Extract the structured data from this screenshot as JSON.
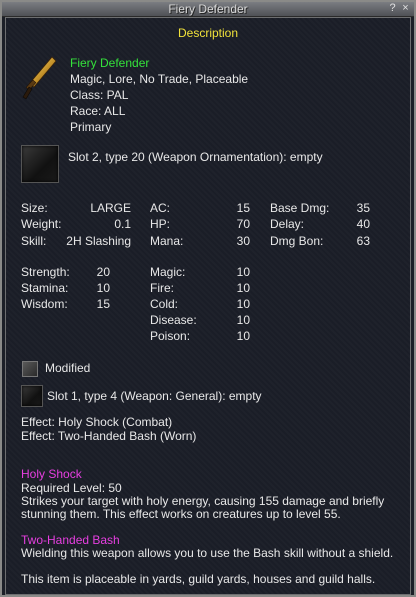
{
  "window": {
    "title": "Fiery Defender",
    "help_label": "?",
    "close_label": "×"
  },
  "header": {
    "title": "Description"
  },
  "item": {
    "name": "Fiery Defender",
    "flags": "Magic, Lore, No Trade, Placeable",
    "class": "Class: PAL",
    "race": "Race: ALL",
    "slot": "Primary"
  },
  "aug_slot_top": "Slot 2, type 20 (Weapon Ornamentation): empty",
  "stats1": {
    "size_label": "Size:",
    "size": "LARGE",
    "weight_label": "Weight:",
    "weight": "0.1",
    "skill_label": "Skill:",
    "skill": "2H Slashing",
    "ac_label": "AC:",
    "ac": "15",
    "hp_label": "HP:",
    "hp": "70",
    "mana_label": "Mana:",
    "mana": "30",
    "basedmg_label": "Base Dmg:",
    "basedmg": "35",
    "delay_label": "Delay:",
    "delay": "40",
    "dmgbon_label": "Dmg Bon:",
    "dmgbon": "63"
  },
  "stats2": {
    "str_label": "Strength:",
    "str": "20",
    "sta_label": "Stamina:",
    "sta": "10",
    "wis_label": "Wisdom:",
    "wis": "15",
    "magic_label": "Magic:",
    "magic": "10",
    "fire_label": "Fire:",
    "fire": "10",
    "cold_label": "Cold:",
    "cold": "10",
    "disease_label": "Disease:",
    "disease": "10",
    "poison_label": "Poison:",
    "poison": "10"
  },
  "modified_label": "Modified",
  "aug_slot_bottom": "Slot 1, type 4 (Weapon: General): empty",
  "effects": {
    "effect1": "Effect: Holy Shock (Combat)",
    "effect2": "Effect: Two-Handed Bash (Worn)"
  },
  "holy_shock": {
    "title": "Holy Shock",
    "level": "Required Level: 50",
    "line1": "Strikes your target with holy energy, causing 155 damage and briefly",
    "line2": "stunning them. This effect works on creatures up to level 55."
  },
  "bash": {
    "title": "Two-Handed Bash",
    "line1": "Wielding this weapon allows you to use the Bash skill without a shield."
  },
  "placeable_note": "This item is placeable in yards, guild yards, houses and guild halls."
}
